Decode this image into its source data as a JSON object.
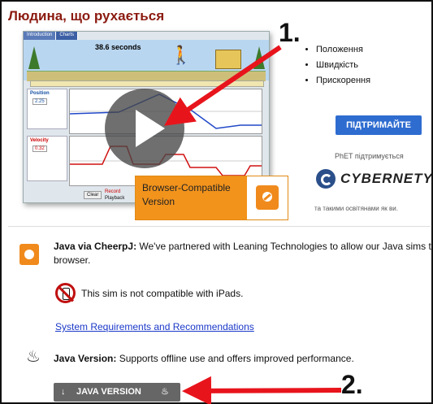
{
  "page_title": "Людина, що рухається",
  "preview": {
    "tabs": [
      "Introduction",
      "Charts"
    ],
    "timer": "38.6 seconds",
    "position_label": "Position",
    "position_value": "2.25",
    "velocity_label": "Velocity",
    "velocity_value": "0.32",
    "bottom_buttons": [
      "Clear",
      "Record",
      "Playback"
    ]
  },
  "browser_tag": "Browser-Compatible Version",
  "topics": [
    "Положення",
    "Швидкість",
    "Прискорення"
  ],
  "support_button": "ПІДТРИМАЙТЕ",
  "phet_supported": "PhET підтримується",
  "sponsor": "CYBERNETYX",
  "sponsor_sub": "та такими освітянами як ви.",
  "cheerp": {
    "bold": "Java via CheerpJ:",
    "text": " We've partnered with Leaning Technologies to allow our Java sims to run in a browser."
  },
  "ipad_note": "This sim is not compatible with iPads.",
  "system_requirements": "System Requirements and Recommendations",
  "java_version": {
    "bold": "Java Version:",
    "text": " Supports offline use and offers improved performance."
  },
  "java_button": "JAVA VERSION",
  "annotations": [
    "1.",
    "2."
  ],
  "colors": {
    "title": "#8b1a10",
    "support": "#2e6cd0",
    "browser_tag": "#f2931c",
    "arrow": "#e8141c",
    "link": "#1a38c8"
  }
}
